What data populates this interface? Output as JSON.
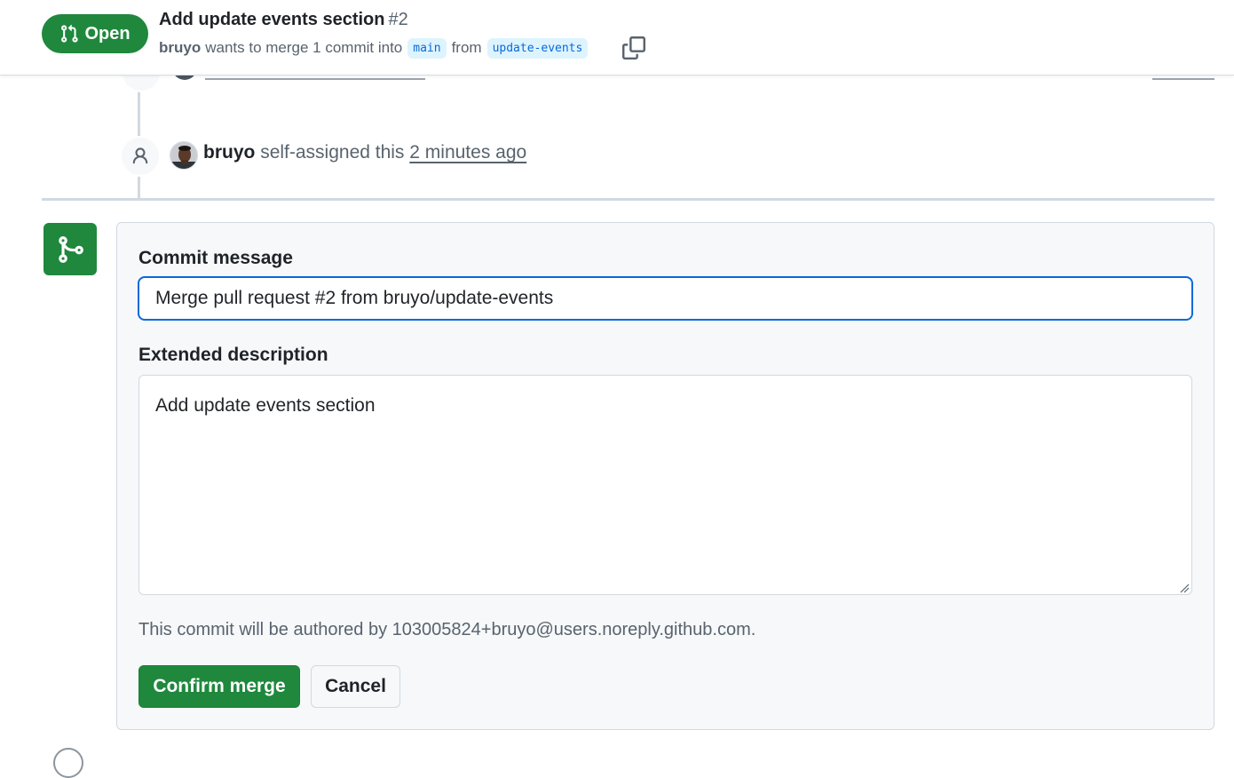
{
  "header": {
    "state_label": "Open",
    "title": "Add update events section",
    "number": "#2",
    "author": "bruyo",
    "merge_text": "wants to merge 1 commit into",
    "base_branch": "main",
    "from_text": "from",
    "head_branch": "update-events"
  },
  "timeline": {
    "event": {
      "actor": "bruyo",
      "action": "self-assigned this",
      "time": "2 minutes ago"
    }
  },
  "merge_form": {
    "commit_message_label": "Commit message",
    "commit_message_value": "Merge pull request #2 from bruyo/update-events",
    "extended_description_label": "Extended description",
    "extended_description_value": "Add update events section",
    "author_note": "This commit will be authored by 103005824+bruyo@users.noreply.github.com.",
    "confirm_label": "Confirm merge",
    "cancel_label": "Cancel"
  },
  "colors": {
    "accent_green": "#1f883d",
    "focus_blue": "#0969da",
    "branch_bg": "#ddf4ff"
  },
  "icons": {
    "state": "git-pull-request-icon",
    "copy": "copy-icon",
    "event": "person-icon",
    "merge": "git-merge-icon"
  }
}
